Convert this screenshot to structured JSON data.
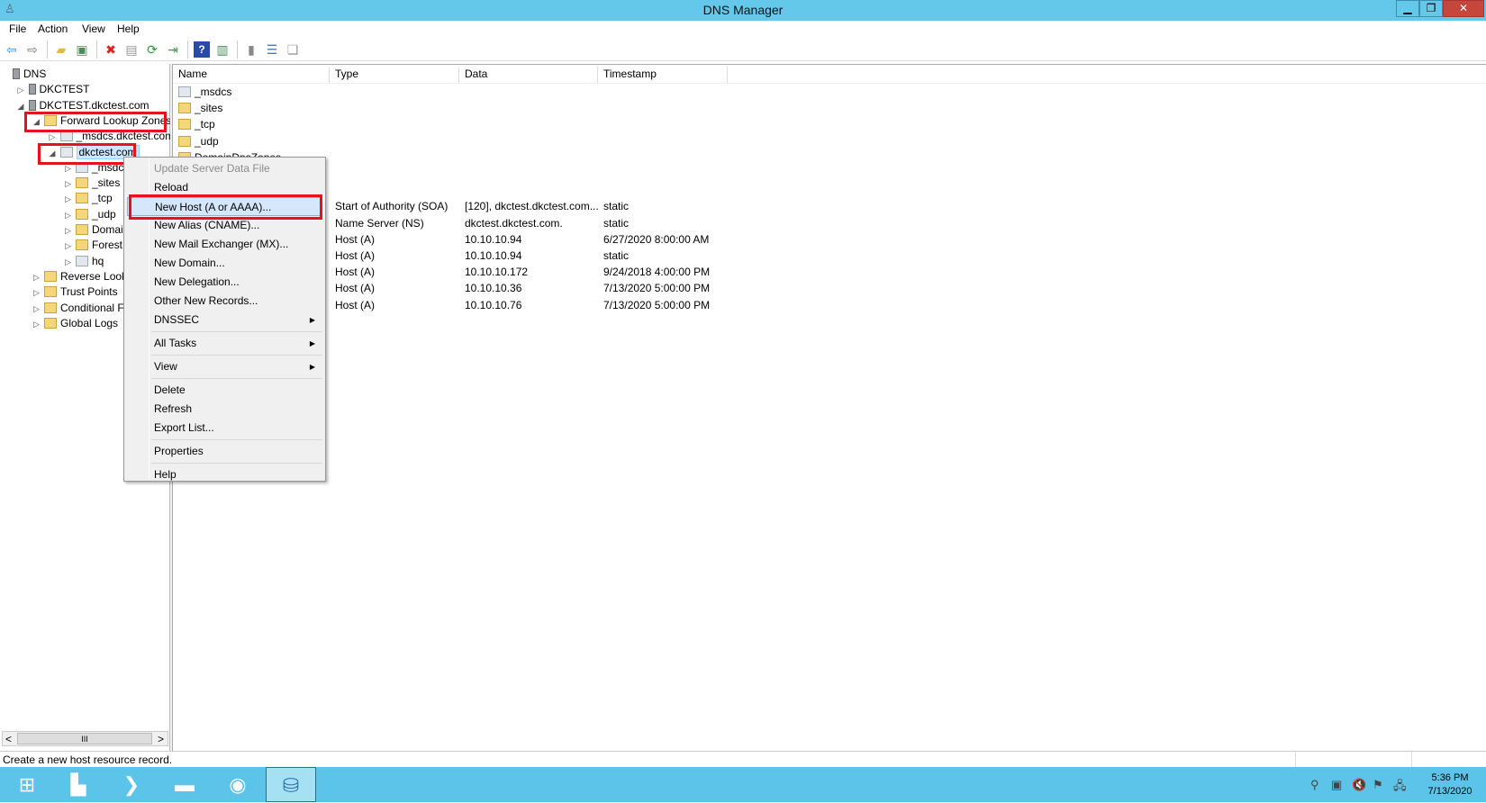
{
  "window": {
    "title": "DNS Manager",
    "minimize": "▁",
    "restore": "❐",
    "close": "✕"
  },
  "menubar": [
    "File",
    "Action",
    "View",
    "Help"
  ],
  "toolbar": [
    {
      "icon": "back-arrow-icon",
      "glyph": "⇦",
      "color": "#3a8fd6"
    },
    {
      "icon": "forward-arrow-icon",
      "glyph": "⇨",
      "color": "#777"
    },
    {
      "sep": true
    },
    {
      "icon": "up-folder-icon",
      "glyph": "▰",
      "color": "#e0b84a"
    },
    {
      "icon": "show-hide-console-tree-icon",
      "glyph": "▣",
      "color": "#4a8f5a"
    },
    {
      "sep": true
    },
    {
      "icon": "delete-icon",
      "glyph": "✖",
      "color": "#e02020"
    },
    {
      "icon": "properties-icon",
      "glyph": "▤",
      "color": "#999"
    },
    {
      "icon": "refresh-icon",
      "glyph": "⟳",
      "color": "#2a9a3a"
    },
    {
      "icon": "export-list-icon",
      "glyph": "⇥",
      "color": "#4a9a4a"
    },
    {
      "sep": true
    },
    {
      "icon": "help-icon",
      "glyph": "?",
      "color": "#fff",
      "bg": "#2a4aa8"
    },
    {
      "icon": "show-action-pane-icon",
      "glyph": "▥",
      "color": "#4a8f5a"
    },
    {
      "sep": true
    },
    {
      "icon": "server-icon",
      "glyph": "▮",
      "color": "#888"
    },
    {
      "icon": "list-view-icon",
      "glyph": "☰",
      "color": "#5577aa"
    },
    {
      "icon": "zone-icon",
      "glyph": "❏",
      "color": "#999"
    }
  ],
  "tree": [
    {
      "label": "DNS",
      "level": 0,
      "exp": "",
      "icon": "dns-icon"
    },
    {
      "label": "DKCTEST",
      "level": 1,
      "exp": "▷",
      "icon": "server-icon"
    },
    {
      "label": "DKCTEST.dkctest.com",
      "level": 1,
      "exp": "◢",
      "icon": "server-icon"
    },
    {
      "label": "Forward Lookup Zones",
      "level": 2,
      "exp": "◢",
      "icon": "folder-icon"
    },
    {
      "label": "_msdcs.dkctest.com",
      "level": 3,
      "exp": "▷",
      "icon": "zone-icon"
    },
    {
      "label": "dkctest.com",
      "level": 3,
      "exp": "◢",
      "icon": "zone-icon",
      "selected": true
    },
    {
      "label": "_msdcs",
      "level": 4,
      "exp": "▷",
      "icon": "zone-icon"
    },
    {
      "label": "_sites",
      "level": 4,
      "exp": "▷",
      "icon": "folder-icon"
    },
    {
      "label": "_tcp",
      "level": 4,
      "exp": "▷",
      "icon": "folder-icon"
    },
    {
      "label": "_udp",
      "level": 4,
      "exp": "▷",
      "icon": "folder-icon"
    },
    {
      "label": "DomainDnsZones",
      "level": 4,
      "exp": "▷",
      "icon": "folder-icon"
    },
    {
      "label": "ForestDnsZones",
      "level": 4,
      "exp": "▷",
      "icon": "folder-icon"
    },
    {
      "label": "hq",
      "level": 4,
      "exp": "▷",
      "icon": "zone-icon"
    },
    {
      "label": "Reverse Lookup Zones",
      "level": 2,
      "exp": "▷",
      "icon": "folder-icon"
    },
    {
      "label": "Trust Points",
      "level": 2,
      "exp": "▷",
      "icon": "folder-icon"
    },
    {
      "label": "Conditional Forwarders",
      "level": 2,
      "exp": "▷",
      "icon": "folder-icon"
    },
    {
      "label": "Global Logs",
      "level": 2,
      "exp": "▷",
      "icon": "log-icon"
    }
  ],
  "list": {
    "columns": [
      "Name",
      "Type",
      "Data",
      "Timestamp"
    ],
    "rows": [
      {
        "name": "_msdcs",
        "icon": "zone-icon",
        "type": "",
        "data": "",
        "ts": ""
      },
      {
        "name": "_sites",
        "icon": "folder-icon",
        "type": "",
        "data": "",
        "ts": ""
      },
      {
        "name": "_tcp",
        "icon": "folder-icon",
        "type": "",
        "data": "",
        "ts": ""
      },
      {
        "name": "_udp",
        "icon": "folder-icon",
        "type": "",
        "data": "",
        "ts": ""
      },
      {
        "name": "DomainDnsZones",
        "icon": "folder-icon",
        "type": "",
        "data": "",
        "ts": ""
      },
      {
        "name": "",
        "icon": "folder-icon",
        "type": "",
        "data": "",
        "ts": ""
      },
      {
        "name": "",
        "icon": "zone-icon",
        "type": "",
        "data": "",
        "ts": ""
      },
      {
        "name": "",
        "icon": "record-icon",
        "type": "Start of Authority (SOA)",
        "data": "[120], dkctest.dkctest.com...",
        "ts": "static"
      },
      {
        "name": "",
        "icon": "record-icon",
        "type": "Name Server (NS)",
        "data": "dkctest.dkctest.com.",
        "ts": "static"
      },
      {
        "name": "",
        "icon": "record-icon",
        "type": "Host (A)",
        "data": "10.10.10.94",
        "ts": "6/27/2020 8:00:00 AM"
      },
      {
        "name": "",
        "icon": "record-icon",
        "type": "Host (A)",
        "data": "10.10.10.94",
        "ts": "static"
      },
      {
        "name": "",
        "icon": "record-icon",
        "type": "Host (A)",
        "data": "10.10.10.172",
        "ts": "9/24/2018 4:00:00 PM"
      },
      {
        "name": "",
        "icon": "record-icon",
        "type": "Host (A)",
        "data": "10.10.10.36",
        "ts": "7/13/2020 5:00:00 PM"
      },
      {
        "name": "",
        "icon": "record-icon",
        "type": "Host (A)",
        "data": "10.10.10.76",
        "ts": "7/13/2020 5:00:00 PM"
      }
    ]
  },
  "context_menu": [
    {
      "label": "Update Server Data File",
      "disabled": true
    },
    {
      "label": "Reload"
    },
    {
      "label": "New Host (A or AAAA)...",
      "highlighted": true
    },
    {
      "label": "New Alias (CNAME)..."
    },
    {
      "label": "New Mail Exchanger (MX)..."
    },
    {
      "label": "New Domain..."
    },
    {
      "label": "New Delegation..."
    },
    {
      "label": "Other New Records..."
    },
    {
      "label": "DNSSEC",
      "submenu": true
    },
    {
      "sep": true
    },
    {
      "label": "All Tasks",
      "submenu": true
    },
    {
      "sep": true
    },
    {
      "label": "View",
      "submenu": true
    },
    {
      "sep": true
    },
    {
      "label": "Delete"
    },
    {
      "label": "Refresh"
    },
    {
      "label": "Export List..."
    },
    {
      "sep": true
    },
    {
      "label": "Properties"
    },
    {
      "sep": true
    },
    {
      "label": "Help"
    }
  ],
  "scrollbar": {
    "left": "<",
    "right": ">",
    "thumb": "III"
  },
  "status": {
    "text": "Create a new host resource record."
  },
  "taskbar": {
    "apps": [
      {
        "name": "start-button",
        "glyph": "⊞"
      },
      {
        "name": "server-manager-button",
        "glyph": "▙"
      },
      {
        "name": "powershell-button",
        "glyph": "❯"
      },
      {
        "name": "file-explorer-button",
        "glyph": "▬"
      },
      {
        "name": "internet-explorer-button",
        "glyph": "◉"
      },
      {
        "name": "dns-manager-button",
        "glyph": "⛁",
        "active": true
      }
    ],
    "tray": [
      "usb-icon",
      "vmware-icon",
      "speaker-muted-icon",
      "action-center-icon",
      "network-icon"
    ],
    "time": "5:36 PM",
    "date": "7/13/2020"
  },
  "colors": {
    "accent": "#63c8e9",
    "highlight": "#e4131f",
    "selection": "#cce8ff"
  }
}
